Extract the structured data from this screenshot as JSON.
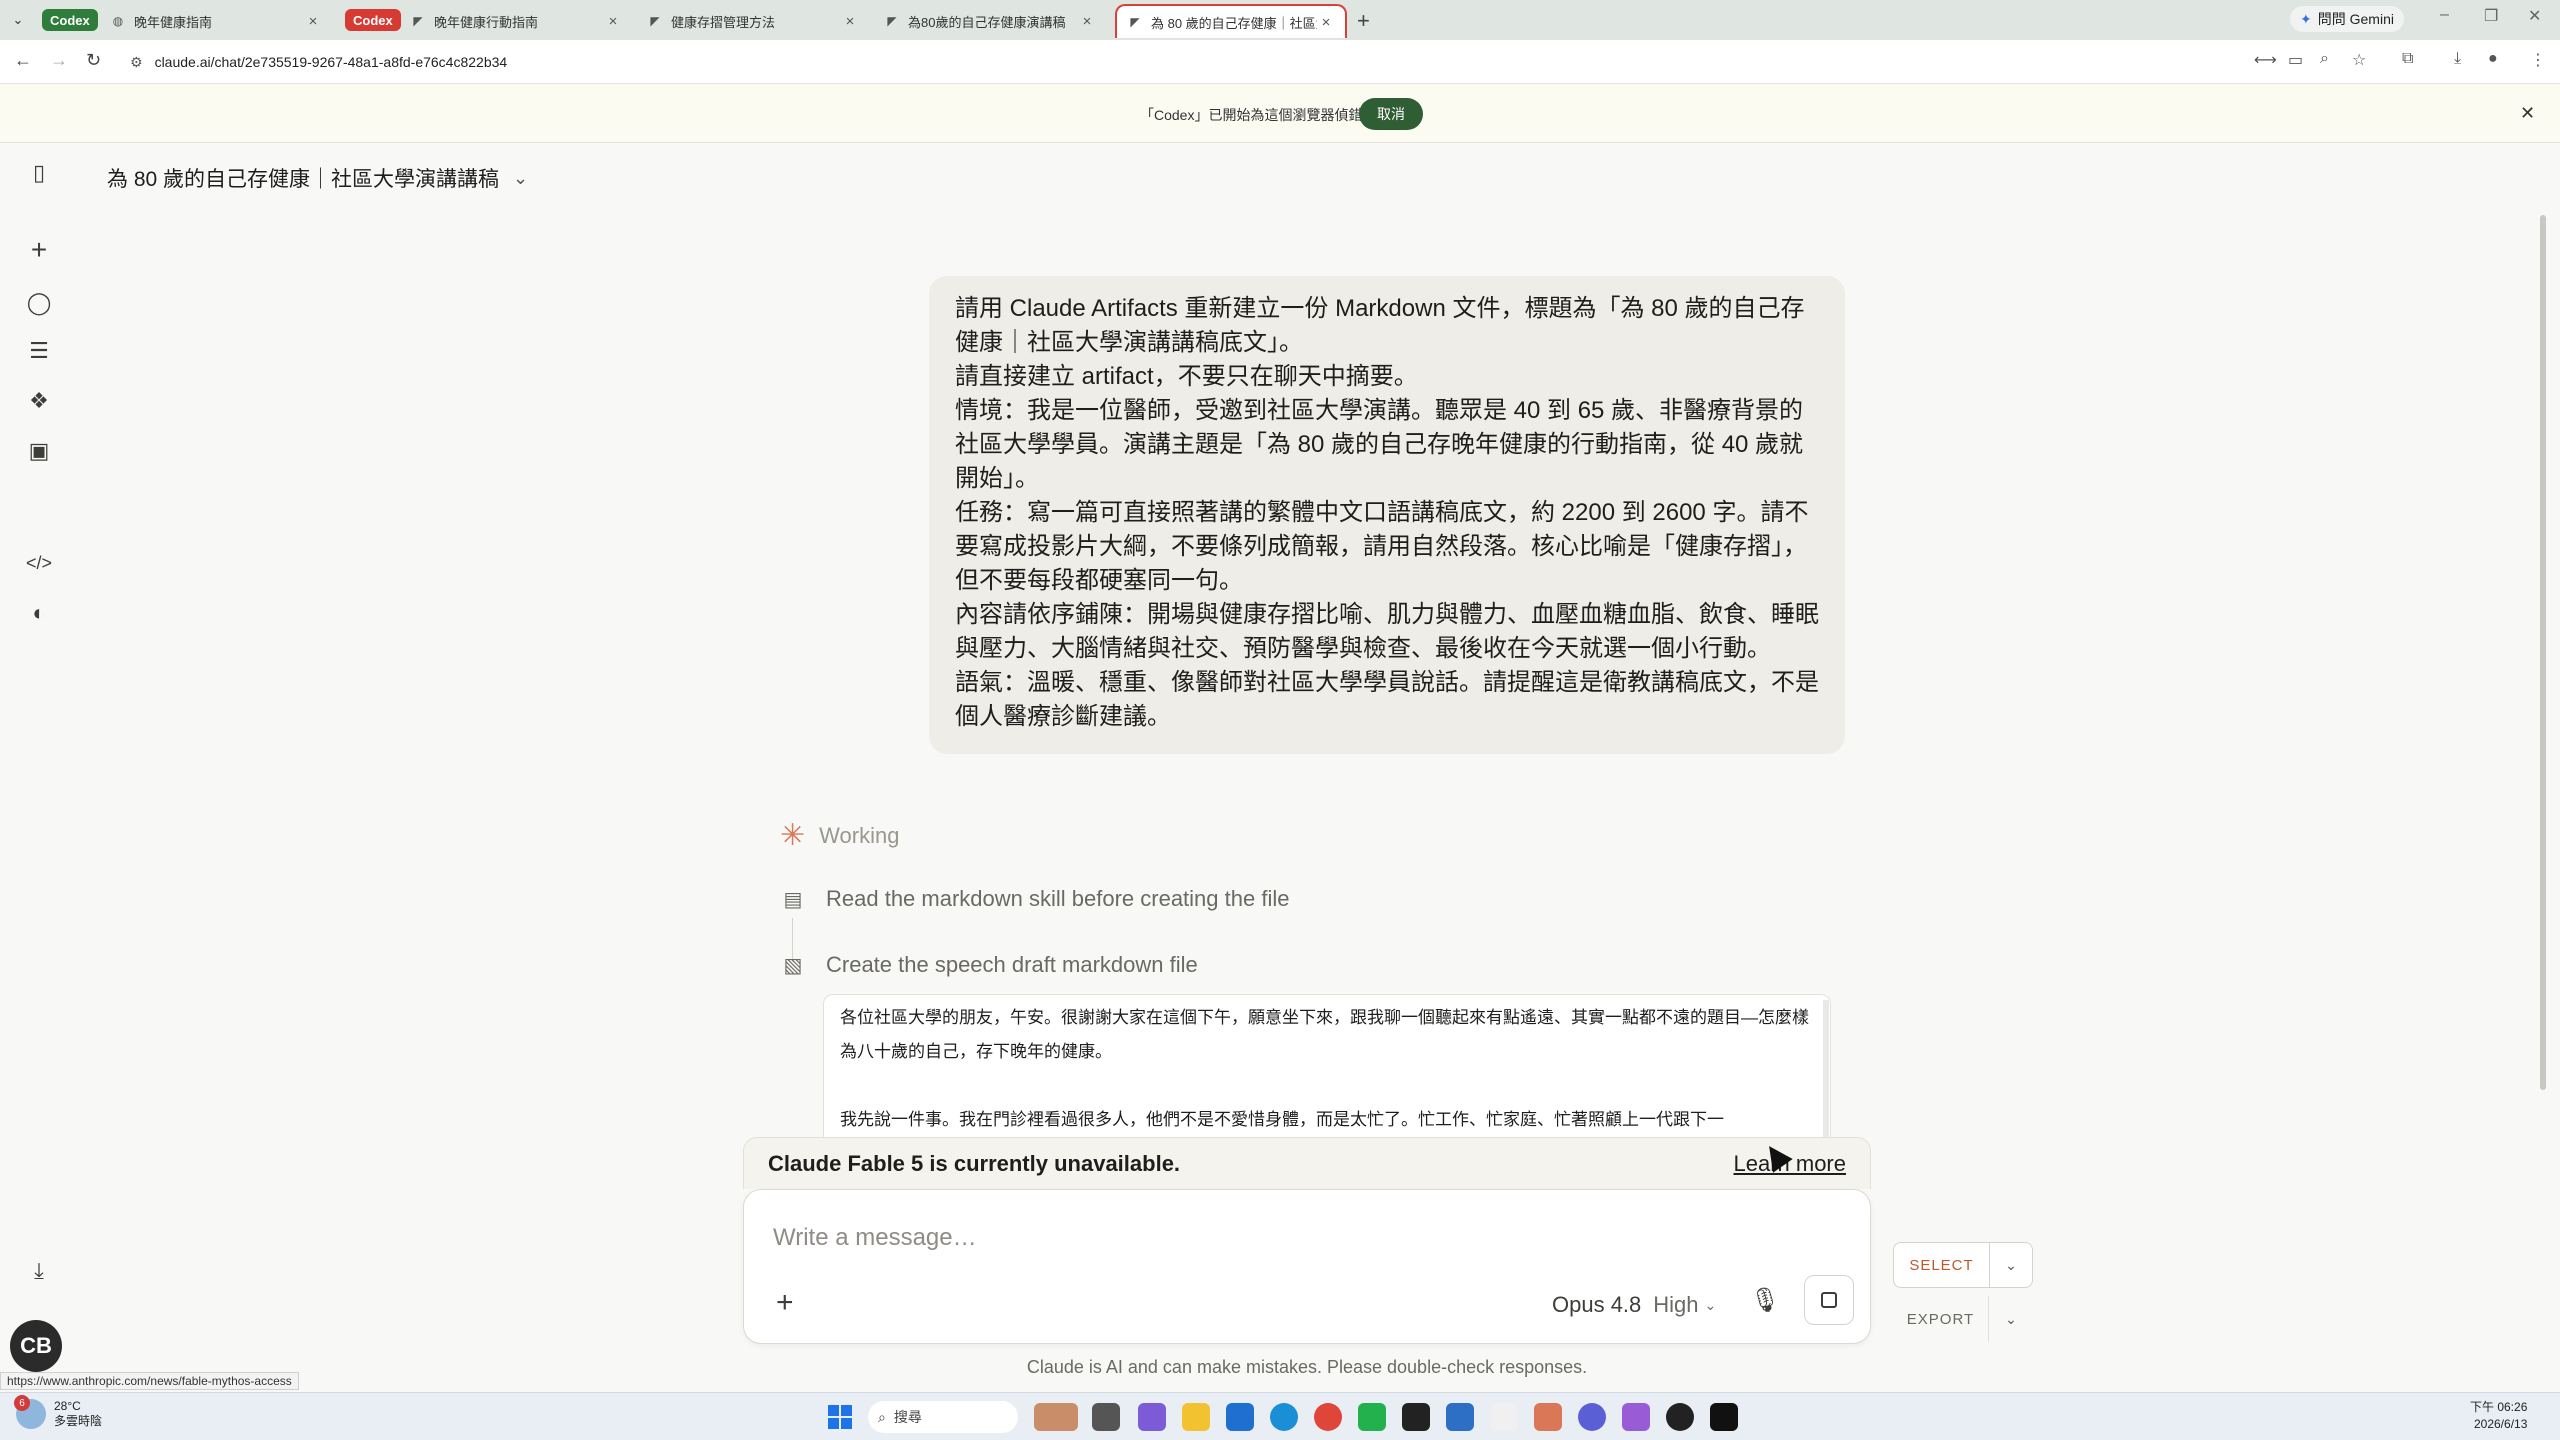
{
  "browser": {
    "tab_groups": [
      {
        "label": "Codex",
        "color": "#2f7d3a"
      },
      {
        "label": "Codex",
        "color": "#d63a33"
      }
    ],
    "tabs": [
      {
        "label": "晚年健康指南"
      },
      {
        "label": "晚年健康行動指南"
      },
      {
        "label": "健康存摺管理方法"
      },
      {
        "label": "為80歲的自己存健康演講稿"
      },
      {
        "label": "為 80 歲的自己存健康｜社區大…"
      }
    ],
    "gemini_label": "問問 Gemini",
    "url": "claude.ai/chat/2e735519-9267-48a1-a8fd-e76c4c822b34"
  },
  "notice": {
    "text": "「Codex」已開始為這個瀏覽器偵錯",
    "cancel_label": "取消"
  },
  "header": {
    "title": "為 80 歲的自己存健康｜社區大學演講講稿"
  },
  "user_message": {
    "lines": [
      "請用 Claude Artifacts 重新建立一份 Markdown 文件，標題為「為 80 歲的自己存健康｜社區大學演講講稿底文」。",
      "請直接建立 artifact，不要只在聊天中摘要。",
      "情境：我是一位醫師，受邀到社區大學演講。聽眾是 40 到 65 歲、非醫療背景的社區大學學員。演講主題是「為 80 歲的自己存晚年健康的行動指南，從 40 歲就開始」。",
      "任務：寫一篇可直接照著講的繁體中文口語講稿底文，約 2200 到 2600 字。請不要寫成投影片大綱，不要條列成簡報，請用自然段落。核心比喻是「健康存摺」，但不要每段都硬塞同一句。",
      "內容請依序鋪陳：開場與健康存摺比喻、肌力與體力、血壓血糖血脂、飲食、睡眠與壓力、大腦情緒與社交、預防醫學與檢查、最後收在今天就選一個小行動。",
      "語氣：溫暖、穩重、像醫師對社區大學學員說話。請提醒這是衛教講稿底文，不是個人醫療診斷建議。"
    ]
  },
  "assistant": {
    "status": "Working",
    "steps": [
      {
        "label": "Read the markdown skill before creating the file",
        "icon": "document-icon"
      },
      {
        "label": "Create the speech draft markdown file",
        "icon": "markdown-file-icon"
      }
    ],
    "preview": {
      "para1": "各位社區大學的朋友，午安。很謝謝大家在這個下午，願意坐下來，跟我聊一個聽起來有點遙遠、其實一點都不遠的題目—怎麼樣為八十歲的自己，存下晚年的健康。",
      "para2": "我先說一件事。我在門診裡看過很多人，他們不是不愛惜身體，而是太忙了。忙工作、忙家庭、忙著照顧上一代跟下一"
    }
  },
  "composer": {
    "unavailable_text": "Claude Fable 5 is currently unavailable.",
    "learn_more": "Learn more",
    "placeholder": "Write a message…",
    "model": "Opus 4.8",
    "effort": "High",
    "disclaimer": "Claude is AI and can make mistakes. Please double-check responses."
  },
  "side_buttons": {
    "select": "SELECT",
    "export": "EXPORT"
  },
  "avatar_initials": "CB",
  "status_url": "https://www.anthropic.com/news/fable-mythos-access",
  "taskbar": {
    "weather_temp": "28°C",
    "weather_desc": "多雲時陰",
    "weather_badge": "6",
    "search_placeholder": "搜尋",
    "time": "下午 06:26",
    "date": "2026/6/13"
  },
  "colors": {
    "accent": "#d97757",
    "cancel_button": "#2f5e35",
    "active_tab_border": "#d8403a"
  }
}
